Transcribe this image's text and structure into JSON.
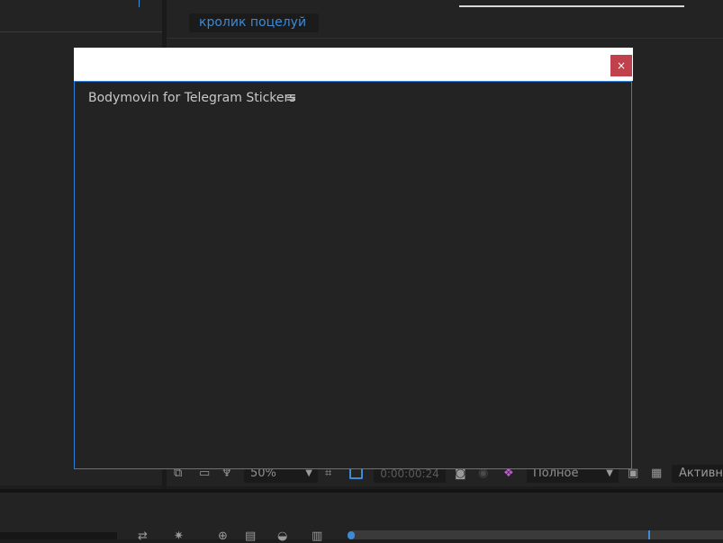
{
  "composition": {
    "tab_label": "кролик поцелуй"
  },
  "viewer_toolbar": {
    "zoom_value": "50%",
    "timecode": "0:00:00:24",
    "resolution_value": "Полное",
    "camera_value": "Активна"
  },
  "dialog": {
    "heading": "Bodymovin for Telegram Stickers",
    "menu_icon": "hamburger-menu-icon",
    "close_symbol": "×"
  },
  "colors": {
    "accent": "#3d8ad6",
    "close_button": "#c0404b",
    "panel_bg": "#232323"
  }
}
